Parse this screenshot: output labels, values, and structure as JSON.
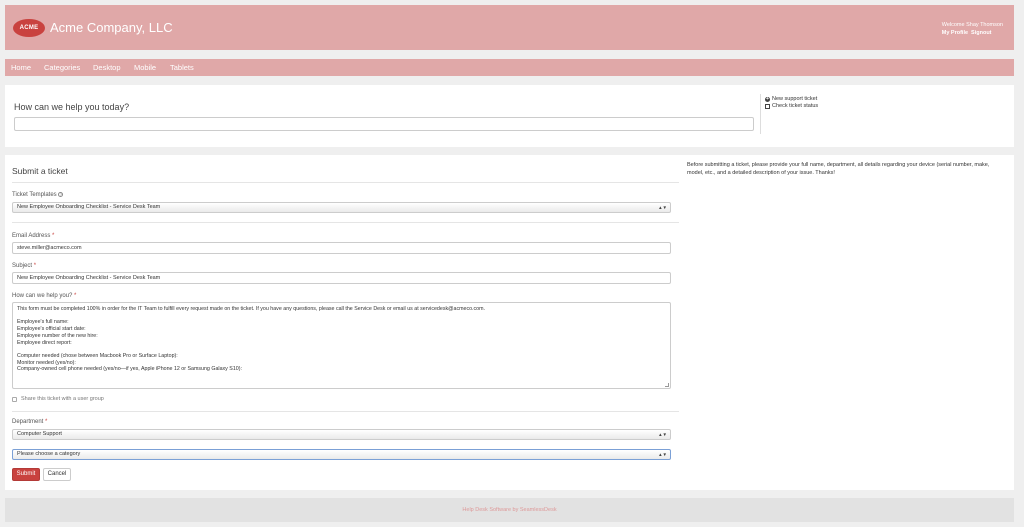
{
  "header": {
    "logo_text": "ACME",
    "company_name": "Acme Company, LLC",
    "welcome": "Welcome Shay Thomson",
    "my_profile": "My Profile",
    "signout": "Signout",
    "color": "#e0a8a8"
  },
  "nav": {
    "items": [
      {
        "label": "Home"
      },
      {
        "label": "Categories"
      },
      {
        "label": "Desktop"
      },
      {
        "label": "Mobile"
      },
      {
        "label": "Tablets"
      }
    ]
  },
  "search": {
    "title": "How can we help you today?",
    "placeholder": ""
  },
  "quick_links": {
    "new_ticket": "New support ticket",
    "check_status": "Check ticket status"
  },
  "form": {
    "title": "Submit a ticket",
    "templates_label": "Ticket Templates",
    "templates_value": "New Employee Onboarding Checklist - Service Desk Team",
    "email_label": "Email Address",
    "email_value": "steve.miller@acmeco.com",
    "subject_label": "Subject",
    "subject_value": "New Employee Onboarding Checklist - Service Desk Team",
    "body_label": "How can we help you?",
    "body_lines": [
      "This form must be completed 100% in order for the IT Team to fulfill every request made on the ticket. If you have any questions, please call the Service Desk or email us at servicedesk@acmeco.com.",
      "",
      "Employee's full name:",
      "Employee's official start date:",
      "Employee number of the new hire:",
      "Employee direct report:",
      "",
      "Computer needed (chose between Macbook Pro or Surface Laptop):",
      "Monitor needed (yes/no):",
      "Company-owned cell phone needed (yes/no—if yes, Apple iPhone 12 or Samsung Galaxy S10):"
    ],
    "share_label": "Share this ticket with a user group",
    "department_label": "Department",
    "department_value": "Computer Support",
    "category_value": "Please choose a category",
    "required_mark": "*",
    "help_mark": "?",
    "submit_label": "Submit",
    "cancel_label": "Cancel",
    "accent_color": "#c9423f"
  },
  "sidebar": {
    "note": "Before submitting a ticket, please provide your full name, department, all details regarding your device (serial number, make, model, etc., and a detailed description of your issue. Thanks!"
  },
  "footer": {
    "text": "Help Desk Software by SeamlessDesk"
  },
  "icons": {
    "plus": "+",
    "updown": "▲▼"
  }
}
